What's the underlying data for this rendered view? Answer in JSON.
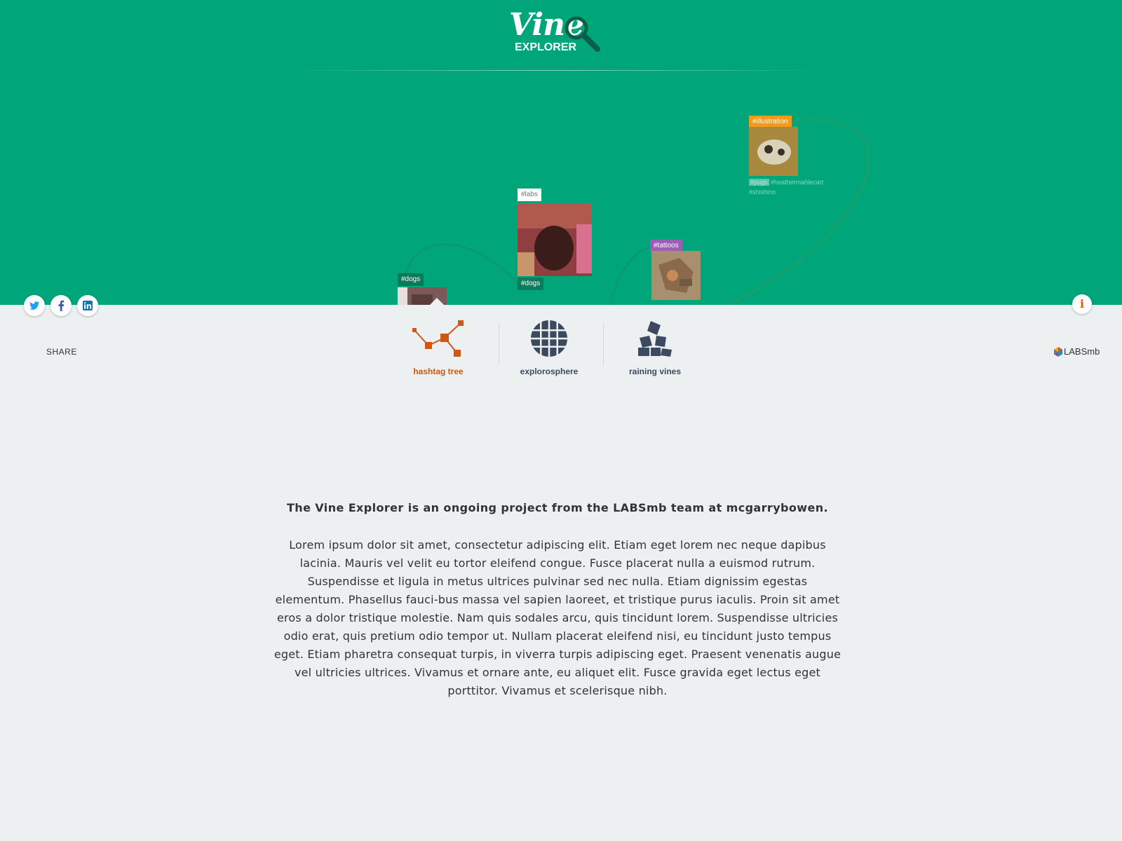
{
  "header": {
    "logo_word": "Vine",
    "logo_sub": "EXPLORER"
  },
  "tree": {
    "nodes": [
      {
        "tag": "#labs",
        "bottom_tag": "#dogs",
        "tag_color": "#ffffff"
      },
      {
        "tag": "#dogs",
        "tag_color": "#0a7a5a"
      },
      {
        "tag": "#tattoos",
        "tag_color": "#9c5fb5"
      },
      {
        "tag": "#illustration",
        "tag_color": "#f39a1a",
        "extra_tags": [
          "#pugs",
          "#heathermahlecart",
          "#shishino"
        ]
      }
    ]
  },
  "share": {
    "label": "SHARE",
    "icons": [
      "twitter-icon",
      "facebook-icon",
      "linkedin-icon"
    ]
  },
  "info_button": {
    "label": "i"
  },
  "brand": {
    "label": "LABSmb"
  },
  "nav": {
    "items": [
      {
        "label": "hashtag tree",
        "icon": "hashtag-tree-icon",
        "active": true
      },
      {
        "label": "explorosphere",
        "icon": "globe-icon",
        "active": false
      },
      {
        "label": "raining vines",
        "icon": "cubes-icon",
        "active": false
      }
    ]
  },
  "about": {
    "intro": "The Vine Explorer is an ongoing project from the LABSmb team at mcgarrybowen.",
    "body": "Lorem ipsum dolor sit amet, consectetur adipiscing elit. Etiam eget lorem nec neque dapibus lacinia. Mauris vel velit eu tortor eleifend congue. Fusce placerat nulla a euismod rutrum. Suspendisse et ligula in metus ultrices pulvinar sed nec nulla. Etiam dignissim egestas elementum. Phasellus fauci-bus massa vel sapien laoreet, et tristique purus iaculis. Proin sit amet eros a dolor tristique molestie. Nam quis sodales arcu, quis tincidunt lorem. Suspendisse ultricies odio erat, quis pretium odio tempor ut. Nullam placerat eleifend nisi, eu tincidunt justo tempus eget. Etiam pharetra consequat turpis, in viverra turpis adipiscing eget. Praesent venenatis augue vel ultricies ultrices. Vivamus et ornare ante, eu aliquet elit. Fusce gravida eget lectus eget porttitor. Vivamus et scelerisque nibh."
  },
  "colors": {
    "hero_bg": "#00a579",
    "page_bg": "#edf0f1",
    "accent": "#d1560f",
    "nav_icon": "#3b4a60"
  }
}
